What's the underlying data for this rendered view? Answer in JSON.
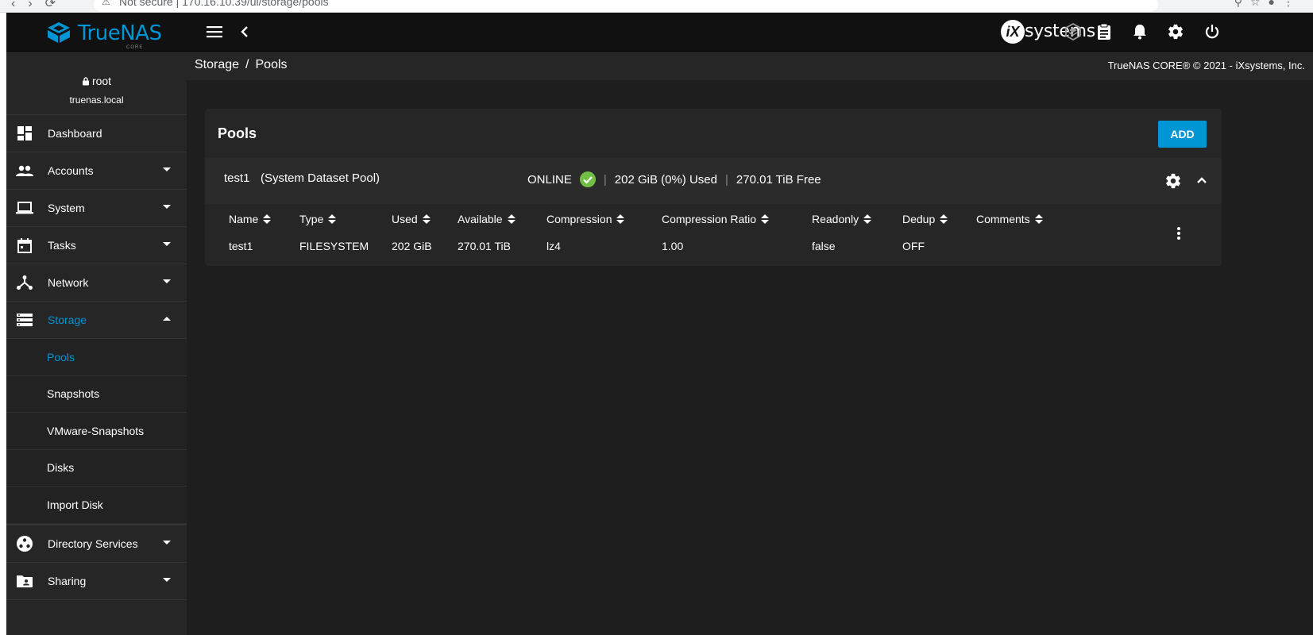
{
  "browser": {
    "security": "Not secure",
    "url": "170.16.10.39/ui/storage/pools"
  },
  "topbar": {
    "brand": "TrueNAS",
    "brand_sub": "CORE",
    "vendor_logo_text": "systems",
    "vendor_logo_mark": "iX",
    "icons": [
      "menu-icon",
      "chevron-left-icon",
      "truecommand-icon",
      "clipboard-icon",
      "bell-icon",
      "gear-icon",
      "power-icon"
    ]
  },
  "sidebar": {
    "user": "root",
    "host": "truenas.local",
    "items": [
      {
        "label": "Dashboard",
        "icon": "dashboard-icon"
      },
      {
        "label": "Accounts",
        "icon": "accounts-icon"
      },
      {
        "label": "System",
        "icon": "laptop-icon"
      },
      {
        "label": "Tasks",
        "icon": "calendar-icon"
      },
      {
        "label": "Network",
        "icon": "network-icon"
      },
      {
        "label": "Storage",
        "icon": "storage-icon"
      },
      {
        "label": "Directory Services",
        "icon": "directory-services-icon"
      },
      {
        "label": "Sharing",
        "icon": "sharing-icon"
      }
    ],
    "storage_sub": [
      "Pools",
      "Snapshots",
      "VMware-Snapshots",
      "Disks",
      "Import Disk"
    ]
  },
  "breadcrumb": {
    "parent": "Storage",
    "separator": "/",
    "current": "Pools"
  },
  "copyright": "TrueNAS CORE® © 2021 - iXsystems, Inc.",
  "card": {
    "title": "Pools",
    "add_label": "ADD"
  },
  "pool": {
    "name": "test1",
    "dataset_note": "(System Dataset Pool)",
    "status": "ONLINE",
    "used": "202 GiB (0%) Used",
    "free": "270.01 TiB Free",
    "divider": "|",
    "status_color": "#71bf44"
  },
  "table": {
    "headers": [
      "Name",
      "Type",
      "Used",
      "Available",
      "Compression",
      "Compression Ratio",
      "Readonly",
      "Dedup",
      "Comments"
    ],
    "rows": [
      [
        "test1",
        "FILESYSTEM",
        "202 GiB",
        "270.01 TiB",
        "lz4",
        "1.00",
        "false",
        "OFF",
        ""
      ]
    ]
  },
  "colors": {
    "accent": "#0095d5",
    "topbar": "#111111",
    "sidebar": "#262626",
    "background": "#1e1e1e"
  }
}
